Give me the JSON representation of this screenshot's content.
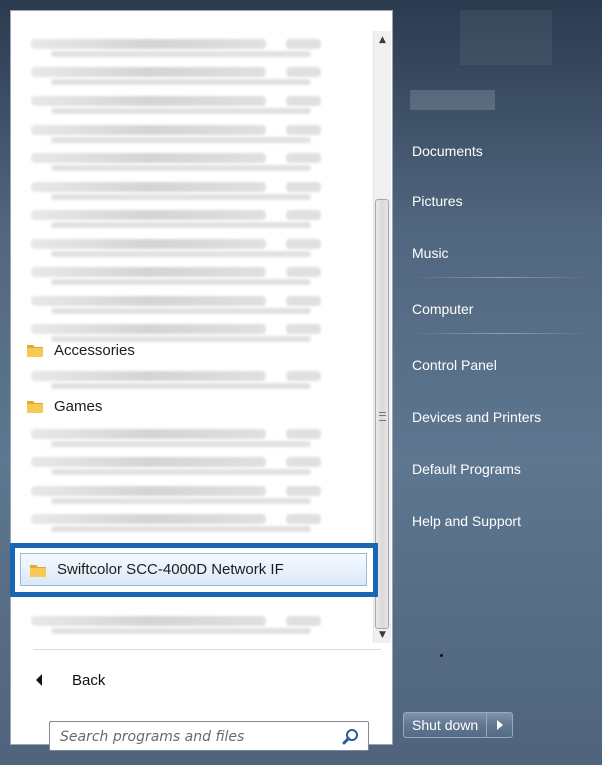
{
  "programs": {
    "folders": [
      {
        "label": "Accessories"
      },
      {
        "label": "Games"
      }
    ],
    "highlighted": {
      "label": "Swiftcolor SCC-4000D Network IF"
    }
  },
  "back": {
    "label": "Back"
  },
  "search": {
    "placeholder": "Search programs and files"
  },
  "right_items": [
    {
      "label": "Documents"
    },
    {
      "label": "Pictures"
    },
    {
      "label": "Music"
    },
    {
      "label": "Computer"
    },
    {
      "label": "Control Panel"
    },
    {
      "label": "Devices and Printers"
    },
    {
      "label": "Default Programs"
    },
    {
      "label": "Help and Support"
    }
  ],
  "shutdown": {
    "label": "Shut down"
  },
  "colors": {
    "highlight_border": "#1767b5",
    "folder": "#e3a92a"
  }
}
